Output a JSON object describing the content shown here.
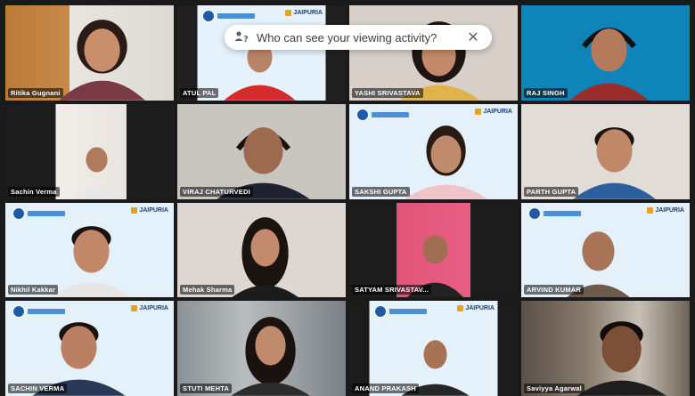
{
  "notice": {
    "text": "Who can see your viewing activity?",
    "icon": "people-question-icon",
    "close_icon": "close-icon"
  },
  "branding": {
    "logo_text": "JAIPURIA",
    "accent": "#1e5aa8",
    "logo_color": "#e8a21b"
  },
  "participants": [
    {
      "name": "Ritika Gugnani"
    },
    {
      "name": "ATUL PAL"
    },
    {
      "name": "YASHI SRIVASTAVA"
    },
    {
      "name": "RAJ SINGH"
    },
    {
      "name": "Sachin Verma"
    },
    {
      "name": "VIRAJ CHATURVEDI"
    },
    {
      "name": "SAKSHI GUPTA"
    },
    {
      "name": "PARTH GUPTA"
    },
    {
      "name": "Nikhil Kakkar"
    },
    {
      "name": "Mehak Sharma"
    },
    {
      "name": "SATYAM SRIVASTAV..."
    },
    {
      "name": "ARVIND KUMAR"
    },
    {
      "name": "SACHIN VERMA"
    },
    {
      "name": "STUTI MEHTA"
    },
    {
      "name": "ANAND PRAKASH"
    },
    {
      "name": "Saviyya Agarwal"
    }
  ]
}
